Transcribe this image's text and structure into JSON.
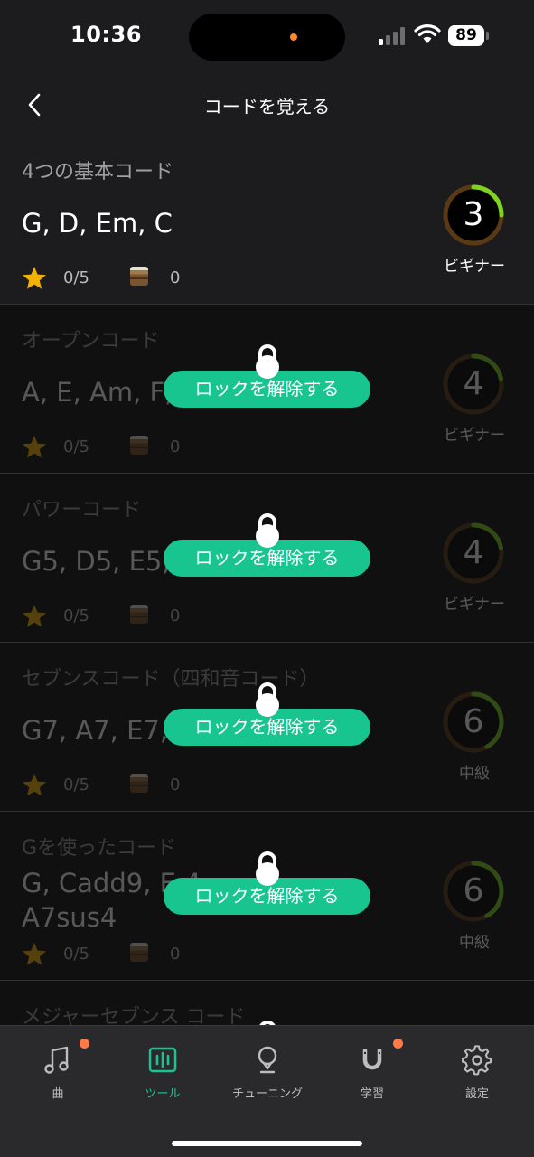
{
  "status": {
    "time": "10:36",
    "battery": "89"
  },
  "nav": {
    "title": "コードを覚える"
  },
  "cards": [
    {
      "category": "4つの基本コード",
      "chords": "G, D, Em, C",
      "stars": "0/5",
      "cases": "0",
      "level": "3",
      "level_label": "ビギナー",
      "locked": false,
      "progress": 0.25
    },
    {
      "category": "オープンコード",
      "chords": "A, E, Am, F,",
      "stars": "0/5",
      "cases": "0",
      "level": "4",
      "level_label": "ビギナー",
      "locked": true,
      "unlock": "ロックを解除する",
      "progress": 0.22
    },
    {
      "category": "パワーコード",
      "chords": "G5, D5, E5,",
      "stars": "0/5",
      "cases": "0",
      "level": "4",
      "level_label": "ビギナー",
      "locked": true,
      "unlock": "ロックを解除する",
      "progress": 0.22
    },
    {
      "category": "セブンスコード（四和音コード）",
      "chords": "G7, A7, E7,",
      "stars": "0/5",
      "cases": "0",
      "level": "6",
      "level_label": "中級",
      "locked": true,
      "unlock": "ロックを解除する",
      "progress": 0.42
    },
    {
      "category": "Gを使ったコード",
      "chords": "G, Cadd9, E      4\nA7sus4",
      "stars": "0/5",
      "cases": "0",
      "level": "6",
      "level_label": "中級",
      "locked": true,
      "unlock": "ロックを解除する",
      "progress": 0.42
    },
    {
      "category": "メジャーセブンス コード",
      "chords": "",
      "stars": "",
      "cases": "",
      "level": "",
      "level_label": "",
      "locked": true,
      "unlock": "",
      "progress": 0
    }
  ],
  "tabs": [
    {
      "label": "曲",
      "icon": "music-note-icon",
      "badge": true
    },
    {
      "label": "ツール",
      "icon": "tools-icon",
      "badge": false,
      "active": true
    },
    {
      "label": "チューニング",
      "icon": "tuner-icon",
      "badge": false
    },
    {
      "label": "学習",
      "icon": "magnet-icon",
      "badge": true
    },
    {
      "label": "設定",
      "icon": "gear-icon",
      "badge": false
    }
  ],
  "colors": {
    "accent": "#19c58f",
    "star": "#f5b100",
    "ring_progress": "#7ed321",
    "badge": "#ff7a45"
  }
}
